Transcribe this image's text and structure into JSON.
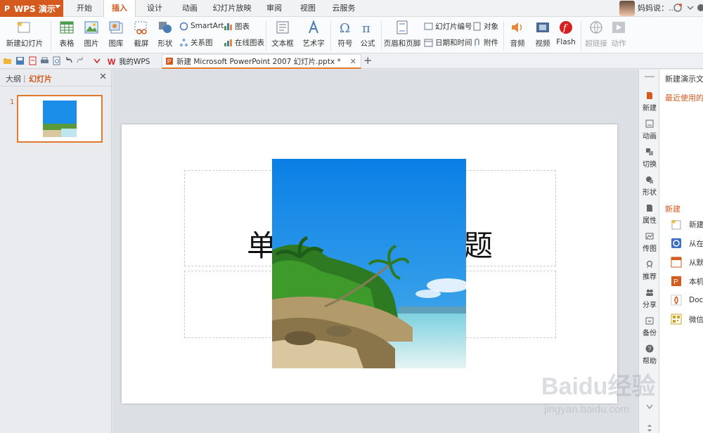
{
  "app": {
    "name": "WPS 演示"
  },
  "menu": {
    "tabs": [
      "开始",
      "插入",
      "设计",
      "动画",
      "幻灯片放映",
      "审阅",
      "视图",
      "云服务"
    ],
    "active_index": 1
  },
  "user": {
    "name": "妈妈说：..."
  },
  "ribbon": {
    "new_slide": "新建幻灯片",
    "table": "表格",
    "picture": "图片",
    "gallery": "图库",
    "screenshot": "截屏",
    "shape": "形状",
    "smartart": "SmartArt",
    "chart": "图表",
    "relation": "关系图",
    "online_chart": "在线图表",
    "textbox": "文本框",
    "wordart": "艺术字",
    "symbol": "符号",
    "formula": "公式",
    "header_footer": "页眉和页脚",
    "slide_number": "幻灯片编号",
    "object": "对象",
    "datetime": "日期和时间",
    "attachment": "附件",
    "audio": "音频",
    "video": "视频",
    "flash": "Flash",
    "hyperlink": "超链接",
    "action": "动作"
  },
  "doc_tabs": {
    "home": "我的WPS",
    "current": "新建 Microsoft PowerPoint 2007 幻灯片.pptx *"
  },
  "left_panel": {
    "outline_tab": "大纲",
    "sep": "|",
    "slides_tab": "幻灯片",
    "slide_number": "1"
  },
  "slide": {
    "title_left": "单",
    "title_right": "题"
  },
  "right_bar": {
    "items": [
      "新建",
      "动画",
      "切换",
      "形状",
      "属性",
      "传图",
      "推荐",
      "分享",
      "备份",
      "帮助"
    ]
  },
  "task_pane": {
    "title": "新建演示文稿",
    "recent": "最近使用的",
    "new_heading": "新建",
    "items": [
      "新建",
      "从在",
      "从默",
      "本机",
      "Doc",
      "微信"
    ]
  },
  "watermark": {
    "brand": "Baidu经验",
    "url": "jingyan.baidu.com"
  },
  "colors": {
    "accent": "#d45a1e",
    "tab_underline": "#e07a2e"
  }
}
